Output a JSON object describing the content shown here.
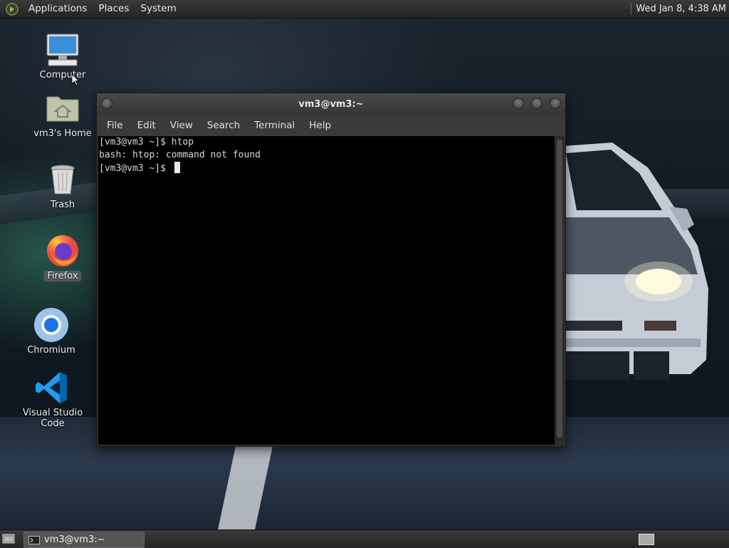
{
  "top_panel": {
    "menus": [
      "Applications",
      "Places",
      "System"
    ],
    "clock": "Wed Jan  8,  4:38 AM"
  },
  "desktop": {
    "icons": [
      {
        "label": "Computer",
        "icon": "computer-icon"
      },
      {
        "label": "vm3's Home",
        "icon": "home-folder-icon"
      },
      {
        "label": "Trash",
        "icon": "trash-icon"
      },
      {
        "label": "Firefox",
        "icon": "firefox-icon"
      },
      {
        "label": "Chromium",
        "icon": "chromium-icon"
      },
      {
        "label": "Visual Studio Code",
        "icon": "vscode-icon"
      }
    ]
  },
  "terminal": {
    "title": "vm3@vm3:~",
    "menu": [
      "File",
      "Edit",
      "View",
      "Search",
      "Terminal",
      "Help"
    ],
    "lines": [
      "[vm3@vm3 ~]$ htop",
      "bash: htop: command not found",
      "[vm3@vm3 ~]$ "
    ]
  },
  "bottom_panel": {
    "task_label": "vm3@vm3:~"
  },
  "colors": {
    "panel": "#2e2e2e",
    "terminal_bg": "#000000",
    "terminal_fg": "#d8d8d8"
  }
}
